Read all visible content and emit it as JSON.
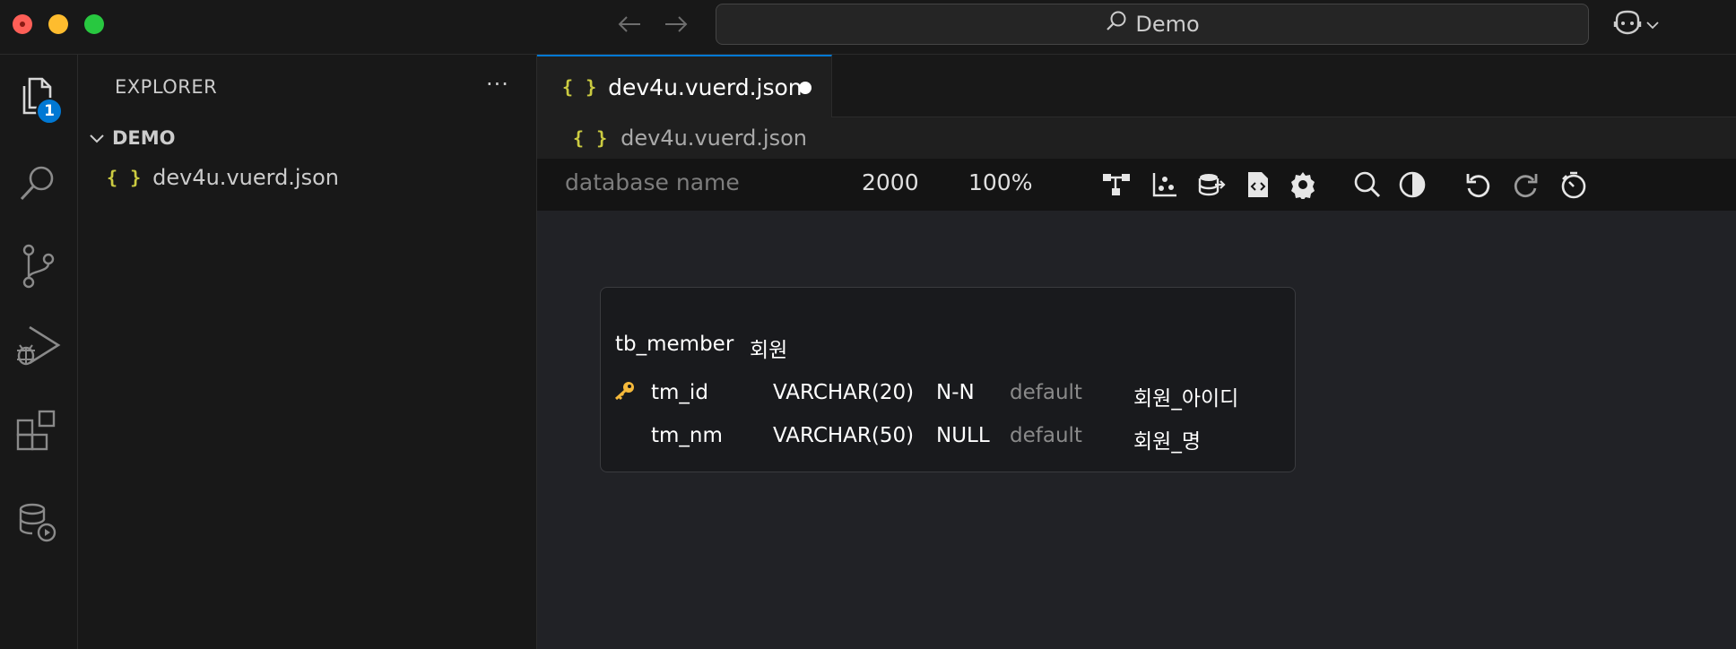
{
  "titlebar": {
    "search_text": "Demo",
    "icons": [
      "back-arrow-icon",
      "forward-arrow-icon",
      "search-icon",
      "copilot-icon",
      "chevron-down-icon"
    ]
  },
  "activity_bar": {
    "items": [
      "explorer-icon",
      "search-icon",
      "source-control-icon",
      "run-debug-icon",
      "extensions-icon",
      "database-run-icon"
    ],
    "explorer_badge": "1"
  },
  "sidebar": {
    "title": "EXPLORER",
    "folder": "DEMO",
    "files": [
      {
        "icon": "{ }",
        "name": "dev4u.vuerd.json"
      }
    ]
  },
  "editor": {
    "tab": {
      "icon": "{ }",
      "label": "dev4u.vuerd.json",
      "dirty": true
    },
    "breadcrumb": {
      "icon": "{ }",
      "label": "dev4u.vuerd.json"
    }
  },
  "erd_toolbar": {
    "database_placeholder": "database name",
    "canvas_size": "2000",
    "zoom": "100%",
    "buttons": [
      "relationship-icon",
      "scatter-icon",
      "database-export-icon",
      "code-file-icon",
      "settings-icon",
      "search-icon",
      "theme-contrast-icon",
      "undo-icon",
      "redo-icon",
      "timer-icon"
    ]
  },
  "erd_table": {
    "name": "tb_member",
    "comment": "회원",
    "columns": [
      {
        "key": true,
        "name": "tm_id",
        "type": "VARCHAR(20)",
        "null": "N-N",
        "default": "default",
        "comment": "회원_아이디"
      },
      {
        "key": false,
        "name": "tm_nm",
        "type": "VARCHAR(50)",
        "null": "NULL",
        "default": "default",
        "comment": "회원_명"
      }
    ]
  },
  "colors": {
    "accent": "#0078d4",
    "json_icon": "#cbcb41",
    "key_icon": "#f5b93b"
  }
}
